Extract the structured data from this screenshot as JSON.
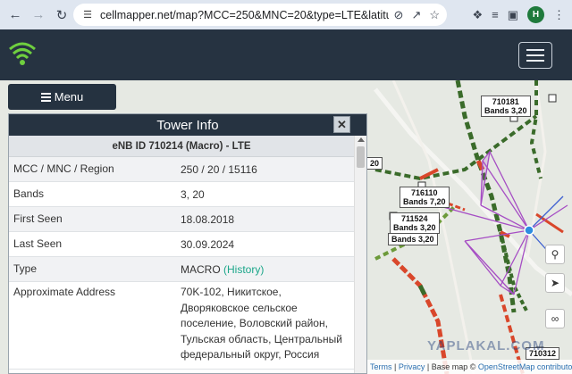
{
  "browser": {
    "url": "cellmapper.net/map?MCC=250&MNC=20&type=LTE&latitud...",
    "avatar_letter": "H"
  },
  "header": {
    "logo_icon": "signal-wifi-icon",
    "menu_icon": "hamburger-icon"
  },
  "menu_button": {
    "label": "Menu"
  },
  "tower_info": {
    "title": "Tower Info",
    "close_label": "✕",
    "subtitle": "eNB ID 710214 (Macro) - LTE",
    "rows": [
      {
        "key": "MCC / MNC / Region",
        "value": "250 / 20 / 15116"
      },
      {
        "key": "Bands",
        "value": "3, 20"
      },
      {
        "key": "First Seen",
        "value": "18.08.2018"
      },
      {
        "key": "Last Seen",
        "value": "30.09.2024"
      },
      {
        "key": "Type",
        "value": "MACRO",
        "link": "(History)"
      },
      {
        "key": "Approximate Address",
        "value": "70K-102, Никитское, Дворяковское сельское поселение, Воловский район, Тульская область, Центральный федеральный округ, Россия"
      }
    ]
  },
  "map_labels": [
    {
      "id": "710181",
      "bands": "Bands 3,20"
    },
    {
      "id": "716110",
      "bands": "Bands 7,20"
    },
    {
      "id": "711524",
      "bands": "Bands 3,20"
    },
    {
      "id": "",
      "bands": "Bands 3,20"
    },
    {
      "id": "710312",
      "bands": ""
    },
    {
      "id": "",
      "bands": "20"
    }
  ],
  "attribution": {
    "terms": "Terms",
    "privacy": "Privacy",
    "basemap": "Base map ©",
    "osm": "OpenStreetMap contributors."
  },
  "watermark": "YAPLAKAL.COM",
  "colors": {
    "header_bg": "#263341",
    "accent_green": "#1aa689",
    "road_red": "#d9472b",
    "road_green": "#3a6b2a",
    "tower_blue": "#2d8de0",
    "sector_purple": "#a64ec4"
  }
}
